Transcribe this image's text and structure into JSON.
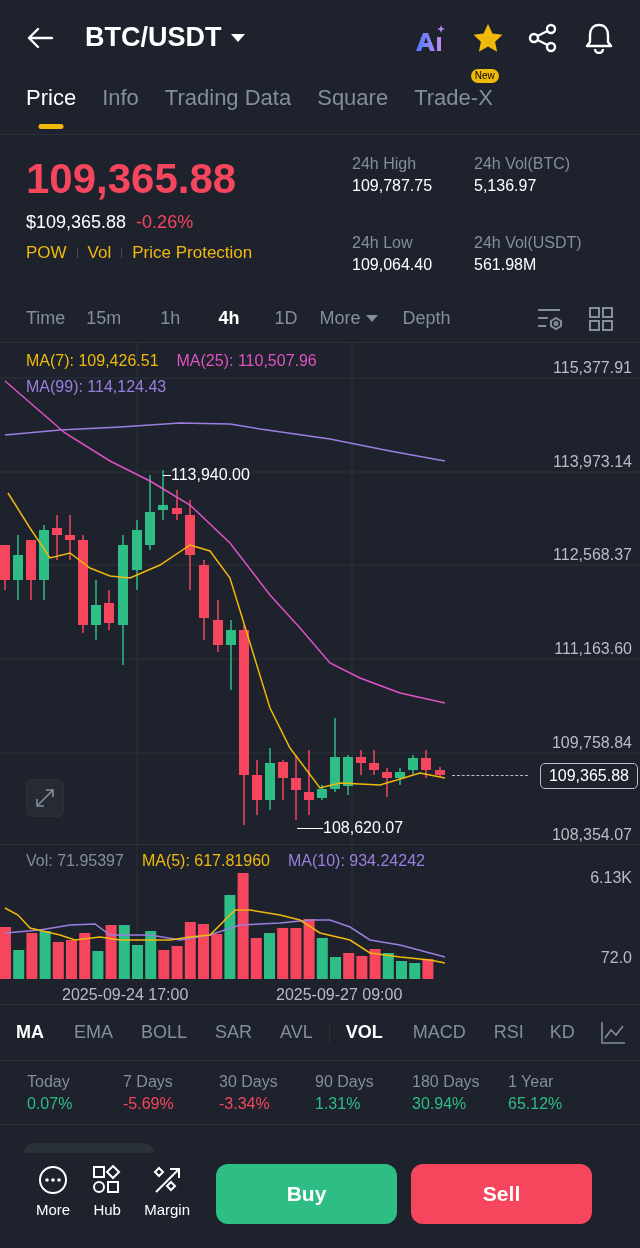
{
  "header": {
    "title": "BTC/USDT"
  },
  "tabs": [
    {
      "label": "Price",
      "selected": true
    },
    {
      "label": "Info",
      "selected": false
    },
    {
      "label": "Trading Data",
      "selected": false
    },
    {
      "label": "Square",
      "selected": false
    },
    {
      "label": "Trade-X",
      "selected": false,
      "badge": "New"
    }
  ],
  "price": {
    "last": "109,365.88",
    "usd": "$109,365.88",
    "change": "-0.26%",
    "tags": [
      "POW",
      "Vol",
      "Price Protection"
    ]
  },
  "stats": [
    {
      "label": "24h High",
      "value": "109,787.75"
    },
    {
      "label": "24h Vol(BTC)",
      "value": "5,136.97"
    },
    {
      "label": "24h Low",
      "value": "109,064.40"
    },
    {
      "label": "24h Vol(USDT)",
      "value": "561.98M"
    }
  ],
  "intervals": [
    {
      "label": "Time",
      "selected": false
    },
    {
      "label": "15m",
      "selected": false
    },
    {
      "label": "1h",
      "selected": false
    },
    {
      "label": "4h",
      "selected": true
    },
    {
      "label": "1D",
      "selected": false
    },
    {
      "label": "More",
      "selected": false,
      "dropdown": true
    },
    {
      "label": "Depth",
      "selected": false
    }
  ],
  "chart": {
    "legend": [
      {
        "text": "MA(7): 109,426.51",
        "color": "#f0b90b"
      },
      {
        "text": "MA(25): 110,507.96",
        "color": "#e052c3"
      },
      {
        "text": "MA(99): 114,124.43",
        "color": "#9b7fe0"
      }
    ],
    "y_labels": [
      "115,377.91",
      "113,973.14",
      "112,568.37",
      "111,163.60",
      "109,758.84",
      "108,354.07"
    ],
    "high_marker": "113,940.00",
    "low_marker": "108,620.07",
    "current_price": "109,365.88"
  },
  "volume": {
    "legend": [
      {
        "text": "Vol: 71.95397",
        "color": "#848e9c"
      },
      {
        "text": "MA(5): 617.81960",
        "color": "#f0b90b"
      },
      {
        "text": "MA(10): 934.24242",
        "color": "#9b7fe0"
      }
    ],
    "y_labels": [
      "6.13K",
      "72.0"
    ],
    "dates": [
      "2025-09-24 17:00",
      "2025-09-27 09:00"
    ]
  },
  "indicators": [
    {
      "label": "MA",
      "selected": true
    },
    {
      "label": "EMA",
      "selected": false
    },
    {
      "label": "BOLL",
      "selected": false
    },
    {
      "label": "SAR",
      "selected": false
    },
    {
      "label": "AVL",
      "selected": false
    },
    {
      "label": "VOL",
      "selected": true
    },
    {
      "label": "MACD",
      "selected": false
    },
    {
      "label": "RSI",
      "selected": false
    },
    {
      "label": "KD",
      "selected": false
    }
  ],
  "performance": [
    {
      "label": "Today",
      "value": "0.07%",
      "color": "#2ebd85"
    },
    {
      "label": "7 Days",
      "value": "-5.69%",
      "color": "#f6465d"
    },
    {
      "label": "30 Days",
      "value": "-3.34%",
      "color": "#f6465d"
    },
    {
      "label": "90 Days",
      "value": "1.31%",
      "color": "#2ebd85"
    },
    {
      "label": "180 Days",
      "value": "30.94%",
      "color": "#2ebd85"
    },
    {
      "label": "1 Year",
      "value": "65.12%",
      "color": "#2ebd85"
    }
  ],
  "bottom_nav": [
    {
      "label": "More",
      "kind": "more"
    },
    {
      "label": "Hub",
      "kind": "hub"
    },
    {
      "label": "Margin",
      "kind": "margin"
    }
  ],
  "actions": [
    {
      "label": "Buy",
      "kind": "buy"
    },
    {
      "label": "Sell",
      "kind": "sell"
    }
  ]
}
